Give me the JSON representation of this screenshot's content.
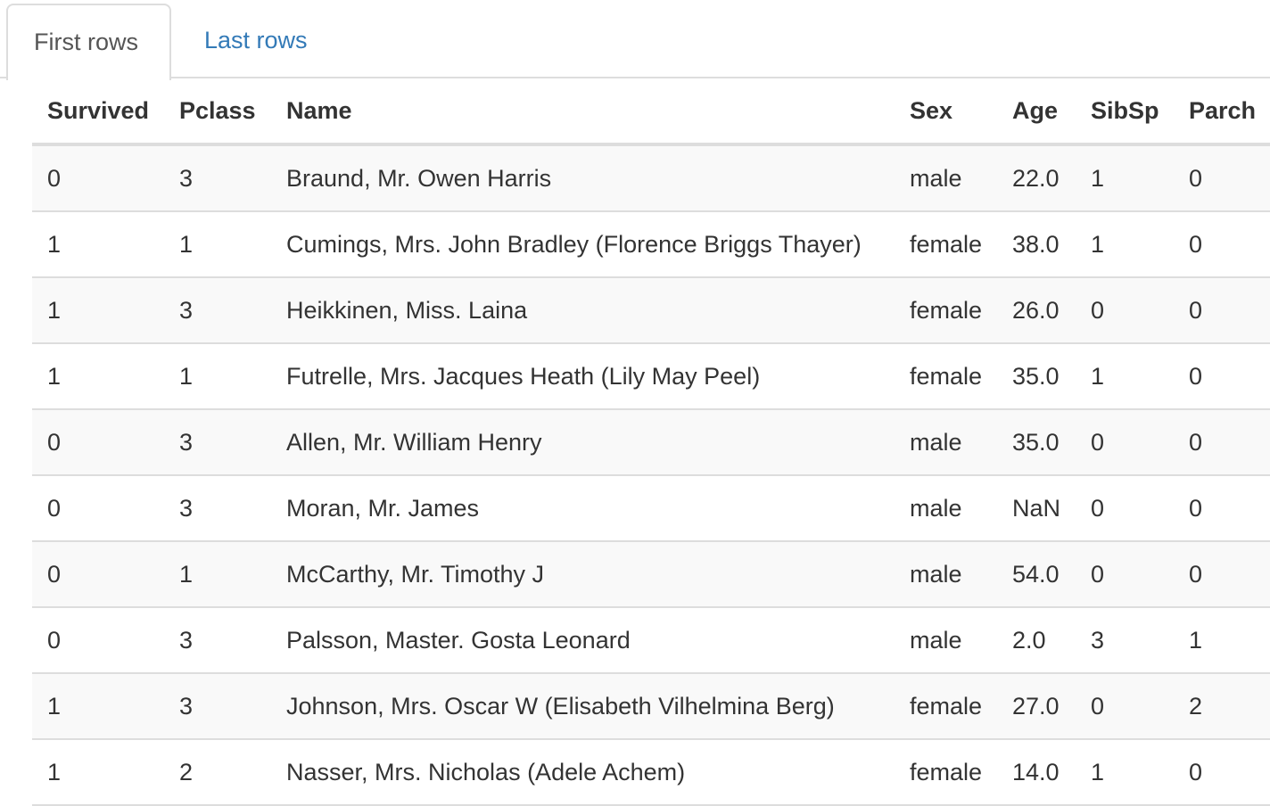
{
  "tabs": {
    "first": "First rows",
    "last": "Last rows"
  },
  "colors": {
    "link": "#337ab7",
    "border": "#dddddd",
    "stripe": "#f9f9f9",
    "text": "#333333"
  },
  "table": {
    "headers": [
      "Survived",
      "Pclass",
      "Name",
      "Sex",
      "Age",
      "SibSp",
      "Parch"
    ],
    "rows": [
      [
        "0",
        "3",
        "Braund, Mr. Owen Harris",
        "male",
        "22.0",
        "1",
        "0"
      ],
      [
        "1",
        "1",
        "Cumings, Mrs. John Bradley (Florence Briggs Thayer)",
        "female",
        "38.0",
        "1",
        "0"
      ],
      [
        "1",
        "3",
        "Heikkinen, Miss. Laina",
        "female",
        "26.0",
        "0",
        "0"
      ],
      [
        "1",
        "1",
        "Futrelle, Mrs. Jacques Heath (Lily May Peel)",
        "female",
        "35.0",
        "1",
        "0"
      ],
      [
        "0",
        "3",
        "Allen, Mr. William Henry",
        "male",
        "35.0",
        "0",
        "0"
      ],
      [
        "0",
        "3",
        "Moran, Mr. James",
        "male",
        "NaN",
        "0",
        "0"
      ],
      [
        "0",
        "1",
        "McCarthy, Mr. Timothy J",
        "male",
        "54.0",
        "0",
        "0"
      ],
      [
        "0",
        "3",
        "Palsson, Master. Gosta Leonard",
        "male",
        "2.0",
        "3",
        "1"
      ],
      [
        "1",
        "3",
        "Johnson, Mrs. Oscar W (Elisabeth Vilhelmina Berg)",
        "female",
        "27.0",
        "0",
        "2"
      ],
      [
        "1",
        "2",
        "Nasser, Mrs. Nicholas (Adele Achem)",
        "female",
        "14.0",
        "1",
        "0"
      ]
    ]
  }
}
